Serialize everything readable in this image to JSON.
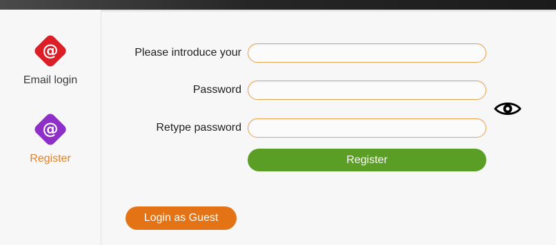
{
  "sidebar": {
    "items": [
      {
        "label": "Email login",
        "icon": "at-sign-icon",
        "color": "#dc1f27",
        "active": false
      },
      {
        "label": "Register",
        "icon": "at-sign-icon",
        "color": "#8e2fc8",
        "active": true
      }
    ],
    "icon_glyph": "@"
  },
  "form": {
    "email_label": "Please introduce your",
    "email_value": "",
    "password_label": "Password",
    "password_value": "",
    "retype_label": "Retype password",
    "retype_value": "",
    "show_password_icon": "eye-icon"
  },
  "actions": {
    "register_label": "Register",
    "register_color": "#5a9e25",
    "guest_label": "Login as Guest",
    "guest_color": "#e47316"
  },
  "theme": {
    "input_border": "#e8a24b",
    "active_nav_color": "#e4812a"
  }
}
